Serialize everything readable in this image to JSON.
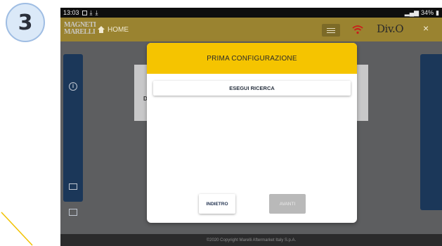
{
  "step": {
    "number": "3"
  },
  "status_bar": {
    "time": "13:03",
    "battery": "34%"
  },
  "app_bar": {
    "logo_line1": "MAGNETI",
    "logo_line2": "MARELLI",
    "home_label": "HOME",
    "brand": "Div.O",
    "close_glyph": "×"
  },
  "background": {
    "card_label": "D"
  },
  "dialog": {
    "title": "PRIMA CONFIGURAZIONE",
    "search_button": "ESEGUI RICERCA",
    "back_button": "INDIETRO",
    "next_button": "AVANTI"
  },
  "footer": {
    "copyright": "©2020 Copyright Marelli Aftermarket Italy S.p.A."
  },
  "colors": {
    "header_yellow": "#f5c400",
    "appbar_gold": "#9a8330",
    "rail_navy": "#1b3759",
    "wifi_red": "#bb1111"
  }
}
